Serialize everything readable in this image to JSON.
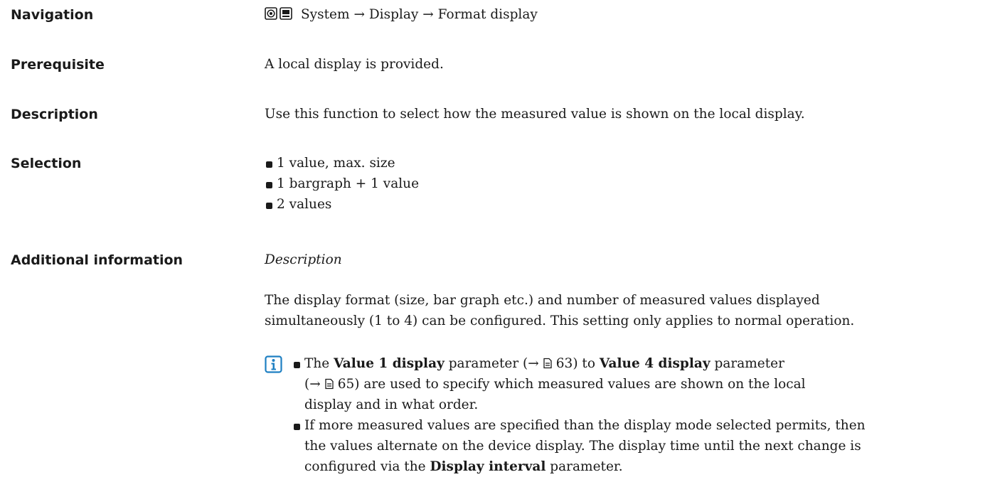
{
  "labels": {
    "navigation": "Navigation",
    "prerequisite": "Prerequisite",
    "description": "Description",
    "selection": "Selection",
    "additional_information": "Additional information"
  },
  "navigation": {
    "icons": [
      "operating-tool-icon",
      "display-icon"
    ],
    "path": [
      "System",
      "Display",
      "Format display"
    ],
    "separator": "→"
  },
  "prerequisite": "A local display is provided.",
  "description": "Use this function to select how the measured value is shown on the local display.",
  "selection": [
    "1 value, max. size",
    "1 bargraph + 1 value",
    "2 values"
  ],
  "additional_information": {
    "subheading": "Description",
    "paragraph_1": "The display format (size, bar graph etc.) and number of measured values displayed",
    "paragraph_2": "simultaneously (1 to 4) can be configured. This setting only applies to normal operation.",
    "info_icon": "info-icon",
    "note1": {
      "t1": "The ",
      "b1": "Value 1 display",
      "t2": " parameter (→",
      "ref1": "63",
      "t3": ") to ",
      "b2": "Value 4 display",
      "t4": " parameter",
      "t5": "(→",
      "ref2": "65",
      "t6": ") are used to specify which measured values are shown on the local",
      "t7": "display and in what order."
    },
    "note2": {
      "l1": "If more measured values are specified than the display mode selected permits, then",
      "l2": "the values alternate on the device display. The display time until the next change is",
      "l3a": "configured via the ",
      "b": "Display interval",
      "l3b": " parameter."
    }
  }
}
